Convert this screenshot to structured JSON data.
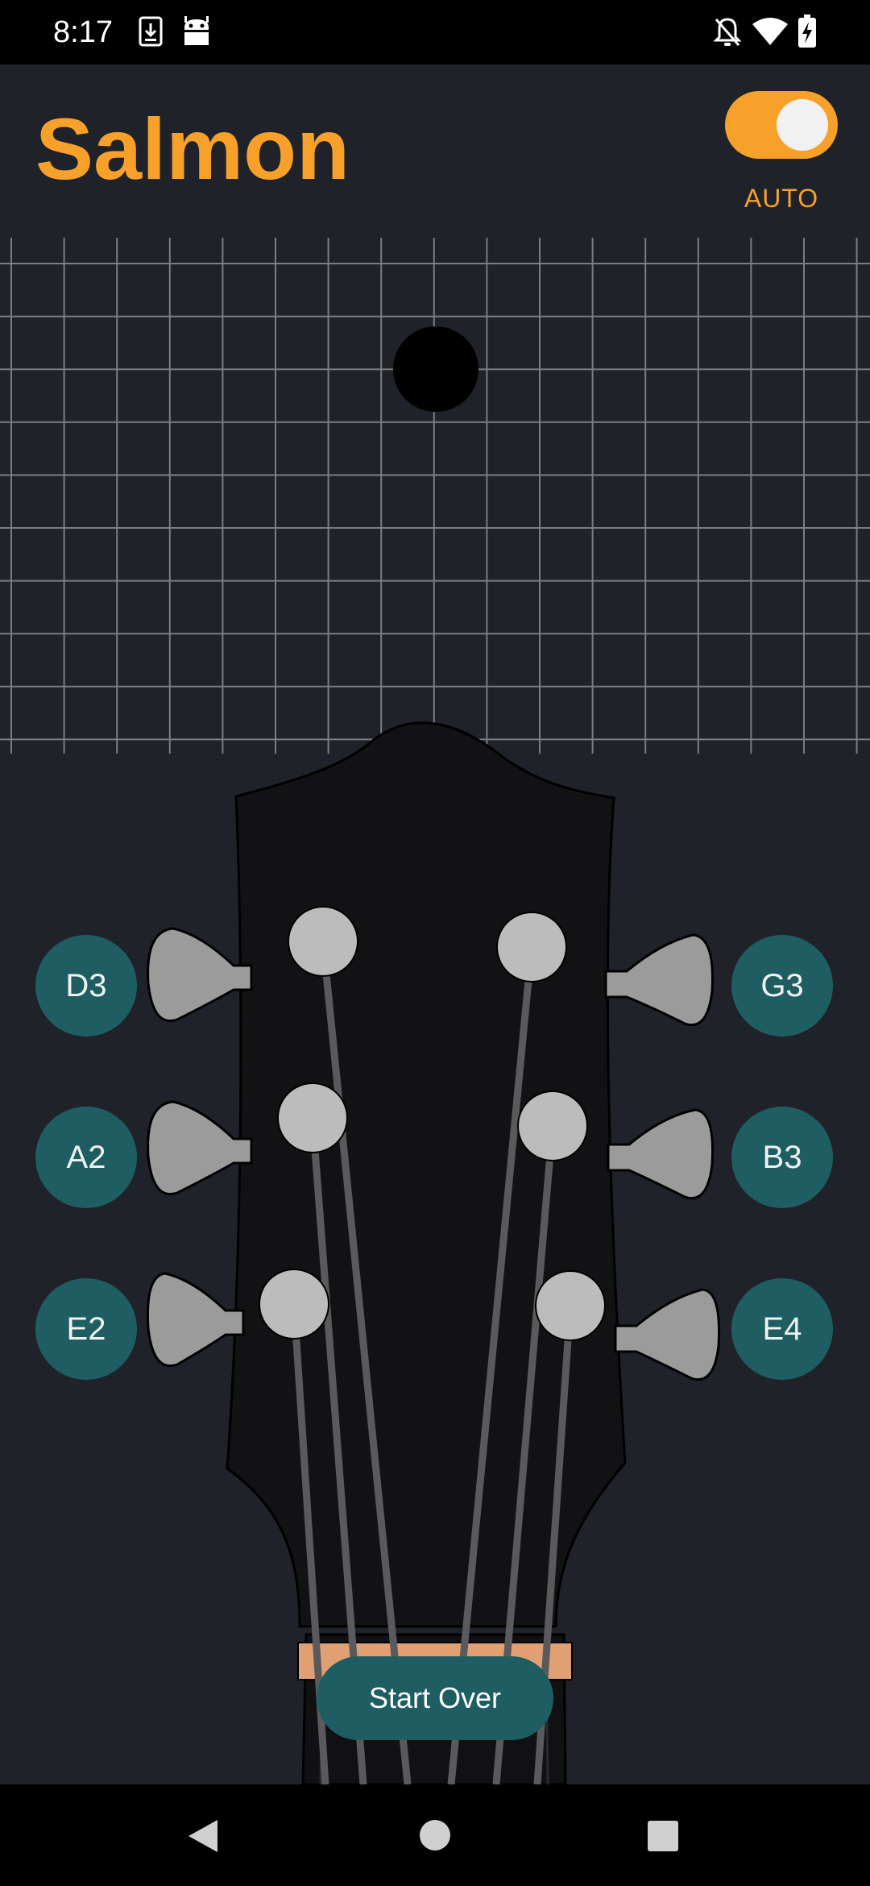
{
  "status_bar": {
    "time": "8:17",
    "icons": [
      "download-icon",
      "android-icon",
      "notifications-off-icon",
      "wifi-icon",
      "battery-charging-icon"
    ]
  },
  "app": {
    "title": "Salmon",
    "auto_label": "AUTO",
    "auto_toggle_on": true,
    "accent_color": "#f7a12a",
    "button_color": "#1e5e62"
  },
  "strings": {
    "left": [
      {
        "label": "D3"
      },
      {
        "label": "A2"
      },
      {
        "label": "E2"
      }
    ],
    "right": [
      {
        "label": "G3"
      },
      {
        "label": "B3"
      },
      {
        "label": "E4"
      }
    ]
  },
  "actions": {
    "start_over": "Start Over"
  },
  "nav_bar": {
    "icons": [
      "back-icon",
      "home-icon",
      "recents-icon"
    ]
  }
}
